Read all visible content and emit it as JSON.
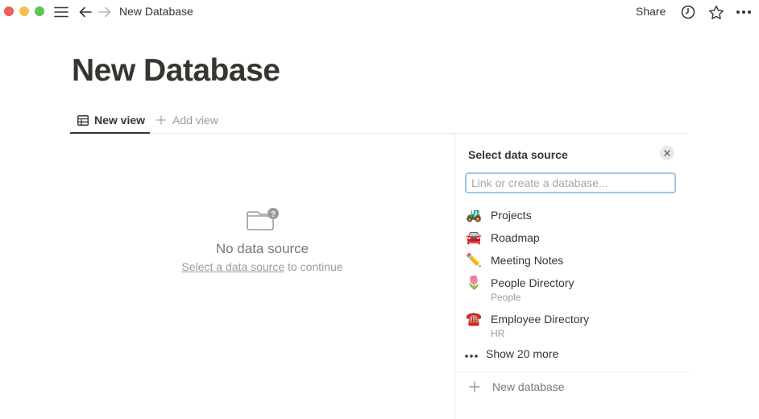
{
  "window": {
    "title": "New Database",
    "share_label": "Share",
    "traffic_lights": {
      "close": "#ee5f57",
      "minimize": "#f4be4f",
      "zoom": "#61c454"
    }
  },
  "page": {
    "title": "New Database",
    "tabs": [
      {
        "label": "New view",
        "icon": "table-icon",
        "active": true
      },
      {
        "label": "Add view",
        "icon": "plus-icon",
        "active": false
      }
    ],
    "empty_state": {
      "icon": "folder-question-icon",
      "title": "No data source",
      "link_text": "Select a data source",
      "suffix": "to continue"
    }
  },
  "panel": {
    "title": "Select data source",
    "search_placeholder": "Link or create a database...",
    "items": [
      {
        "name": "Projects",
        "emoji": "🚜",
        "subtitle": ""
      },
      {
        "name": "Roadmap",
        "emoji": "🚘",
        "subtitle": ""
      },
      {
        "name": "Meeting Notes",
        "emoji": "✏️",
        "subtitle": ""
      },
      {
        "name": "People Directory",
        "emoji": "🌷",
        "subtitle": "People"
      },
      {
        "name": "Employee Directory",
        "emoji": "☎️",
        "subtitle": "HR"
      }
    ],
    "show_more_label": "Show 20 more",
    "new_database_label": "New database"
  },
  "colors": {
    "text": "#37352f",
    "muted": "#9b9a97",
    "border": "#e9e9e7",
    "focus_ring": "#9fc6e6"
  }
}
